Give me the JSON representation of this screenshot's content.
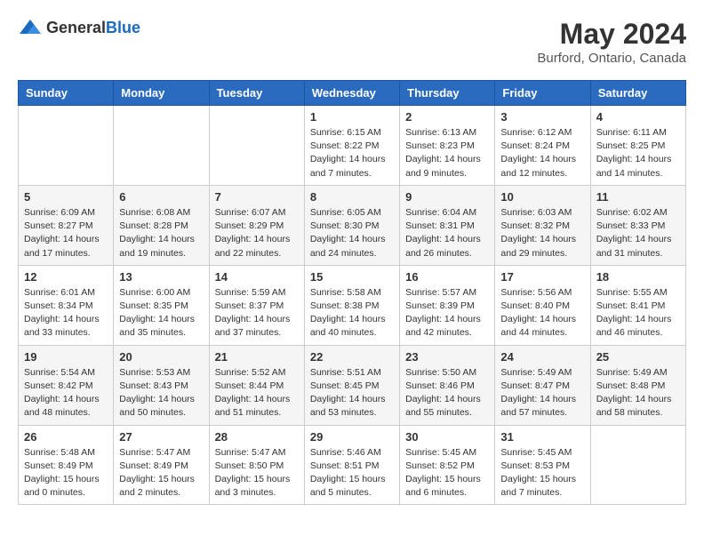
{
  "logo": {
    "text_general": "General",
    "text_blue": "Blue"
  },
  "title": {
    "month_year": "May 2024",
    "location": "Burford, Ontario, Canada"
  },
  "weekdays": [
    "Sunday",
    "Monday",
    "Tuesday",
    "Wednesday",
    "Thursday",
    "Friday",
    "Saturday"
  ],
  "weeks": [
    [
      {
        "day": "",
        "sunrise": "",
        "sunset": "",
        "daylight": ""
      },
      {
        "day": "",
        "sunrise": "",
        "sunset": "",
        "daylight": ""
      },
      {
        "day": "",
        "sunrise": "",
        "sunset": "",
        "daylight": ""
      },
      {
        "day": "1",
        "sunrise": "Sunrise: 6:15 AM",
        "sunset": "Sunset: 8:22 PM",
        "daylight": "Daylight: 14 hours and 7 minutes."
      },
      {
        "day": "2",
        "sunrise": "Sunrise: 6:13 AM",
        "sunset": "Sunset: 8:23 PM",
        "daylight": "Daylight: 14 hours and 9 minutes."
      },
      {
        "day": "3",
        "sunrise": "Sunrise: 6:12 AM",
        "sunset": "Sunset: 8:24 PM",
        "daylight": "Daylight: 14 hours and 12 minutes."
      },
      {
        "day": "4",
        "sunrise": "Sunrise: 6:11 AM",
        "sunset": "Sunset: 8:25 PM",
        "daylight": "Daylight: 14 hours and 14 minutes."
      }
    ],
    [
      {
        "day": "5",
        "sunrise": "Sunrise: 6:09 AM",
        "sunset": "Sunset: 8:27 PM",
        "daylight": "Daylight: 14 hours and 17 minutes."
      },
      {
        "day": "6",
        "sunrise": "Sunrise: 6:08 AM",
        "sunset": "Sunset: 8:28 PM",
        "daylight": "Daylight: 14 hours and 19 minutes."
      },
      {
        "day": "7",
        "sunrise": "Sunrise: 6:07 AM",
        "sunset": "Sunset: 8:29 PM",
        "daylight": "Daylight: 14 hours and 22 minutes."
      },
      {
        "day": "8",
        "sunrise": "Sunrise: 6:05 AM",
        "sunset": "Sunset: 8:30 PM",
        "daylight": "Daylight: 14 hours and 24 minutes."
      },
      {
        "day": "9",
        "sunrise": "Sunrise: 6:04 AM",
        "sunset": "Sunset: 8:31 PM",
        "daylight": "Daylight: 14 hours and 26 minutes."
      },
      {
        "day": "10",
        "sunrise": "Sunrise: 6:03 AM",
        "sunset": "Sunset: 8:32 PM",
        "daylight": "Daylight: 14 hours and 29 minutes."
      },
      {
        "day": "11",
        "sunrise": "Sunrise: 6:02 AM",
        "sunset": "Sunset: 8:33 PM",
        "daylight": "Daylight: 14 hours and 31 minutes."
      }
    ],
    [
      {
        "day": "12",
        "sunrise": "Sunrise: 6:01 AM",
        "sunset": "Sunset: 8:34 PM",
        "daylight": "Daylight: 14 hours and 33 minutes."
      },
      {
        "day": "13",
        "sunrise": "Sunrise: 6:00 AM",
        "sunset": "Sunset: 8:35 PM",
        "daylight": "Daylight: 14 hours and 35 minutes."
      },
      {
        "day": "14",
        "sunrise": "Sunrise: 5:59 AM",
        "sunset": "Sunset: 8:37 PM",
        "daylight": "Daylight: 14 hours and 37 minutes."
      },
      {
        "day": "15",
        "sunrise": "Sunrise: 5:58 AM",
        "sunset": "Sunset: 8:38 PM",
        "daylight": "Daylight: 14 hours and 40 minutes."
      },
      {
        "day": "16",
        "sunrise": "Sunrise: 5:57 AM",
        "sunset": "Sunset: 8:39 PM",
        "daylight": "Daylight: 14 hours and 42 minutes."
      },
      {
        "day": "17",
        "sunrise": "Sunrise: 5:56 AM",
        "sunset": "Sunset: 8:40 PM",
        "daylight": "Daylight: 14 hours and 44 minutes."
      },
      {
        "day": "18",
        "sunrise": "Sunrise: 5:55 AM",
        "sunset": "Sunset: 8:41 PM",
        "daylight": "Daylight: 14 hours and 46 minutes."
      }
    ],
    [
      {
        "day": "19",
        "sunrise": "Sunrise: 5:54 AM",
        "sunset": "Sunset: 8:42 PM",
        "daylight": "Daylight: 14 hours and 48 minutes."
      },
      {
        "day": "20",
        "sunrise": "Sunrise: 5:53 AM",
        "sunset": "Sunset: 8:43 PM",
        "daylight": "Daylight: 14 hours and 50 minutes."
      },
      {
        "day": "21",
        "sunrise": "Sunrise: 5:52 AM",
        "sunset": "Sunset: 8:44 PM",
        "daylight": "Daylight: 14 hours and 51 minutes."
      },
      {
        "day": "22",
        "sunrise": "Sunrise: 5:51 AM",
        "sunset": "Sunset: 8:45 PM",
        "daylight": "Daylight: 14 hours and 53 minutes."
      },
      {
        "day": "23",
        "sunrise": "Sunrise: 5:50 AM",
        "sunset": "Sunset: 8:46 PM",
        "daylight": "Daylight: 14 hours and 55 minutes."
      },
      {
        "day": "24",
        "sunrise": "Sunrise: 5:49 AM",
        "sunset": "Sunset: 8:47 PM",
        "daylight": "Daylight: 14 hours and 57 minutes."
      },
      {
        "day": "25",
        "sunrise": "Sunrise: 5:49 AM",
        "sunset": "Sunset: 8:48 PM",
        "daylight": "Daylight: 14 hours and 58 minutes."
      }
    ],
    [
      {
        "day": "26",
        "sunrise": "Sunrise: 5:48 AM",
        "sunset": "Sunset: 8:49 PM",
        "daylight": "Daylight: 15 hours and 0 minutes."
      },
      {
        "day": "27",
        "sunrise": "Sunrise: 5:47 AM",
        "sunset": "Sunset: 8:49 PM",
        "daylight": "Daylight: 15 hours and 2 minutes."
      },
      {
        "day": "28",
        "sunrise": "Sunrise: 5:47 AM",
        "sunset": "Sunset: 8:50 PM",
        "daylight": "Daylight: 15 hours and 3 minutes."
      },
      {
        "day": "29",
        "sunrise": "Sunrise: 5:46 AM",
        "sunset": "Sunset: 8:51 PM",
        "daylight": "Daylight: 15 hours and 5 minutes."
      },
      {
        "day": "30",
        "sunrise": "Sunrise: 5:45 AM",
        "sunset": "Sunset: 8:52 PM",
        "daylight": "Daylight: 15 hours and 6 minutes."
      },
      {
        "day": "31",
        "sunrise": "Sunrise: 5:45 AM",
        "sunset": "Sunset: 8:53 PM",
        "daylight": "Daylight: 15 hours and 7 minutes."
      },
      {
        "day": "",
        "sunrise": "",
        "sunset": "",
        "daylight": ""
      }
    ]
  ]
}
